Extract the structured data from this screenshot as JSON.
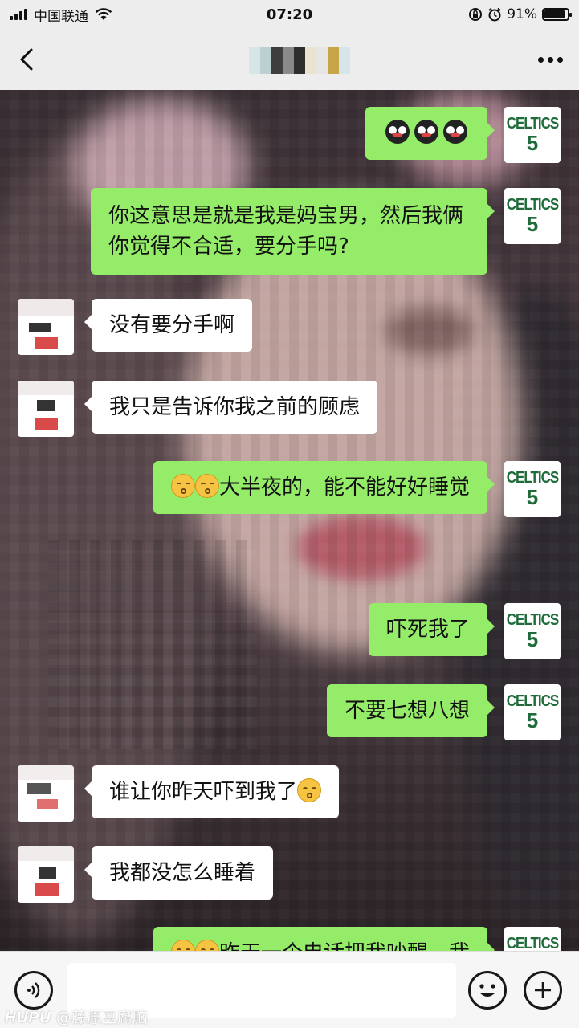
{
  "status_bar": {
    "carrier": "中国联通",
    "time": "07:20",
    "battery": "91%",
    "battery_level": 0.91
  },
  "nav": {
    "back_icon": "chevron-left-icon",
    "more_icon": "more-icon"
  },
  "avatar_me": {
    "line1": "CELTICS",
    "line2": "5",
    "color": "#1f6b3a"
  },
  "messages": [
    {
      "from": "me",
      "text": "",
      "emojis": [
        "eyes-emoji",
        "eyes-emoji",
        "eyes-emoji"
      ]
    },
    {
      "from": "me",
      "text": "你这意思是就是我是妈宝男，然后我俩你觉得不合适，要分手吗?"
    },
    {
      "from": "other",
      "text": "没有要分手啊"
    },
    {
      "from": "other",
      "text": "我只是告诉你我之前的顾虑"
    },
    {
      "from": "me",
      "text": "大半夜的，能不能好好睡觉",
      "emoji_prefix": [
        "blush-emoji",
        "blush-emoji"
      ]
    },
    {
      "from": "me",
      "text": "吓死我了"
    },
    {
      "from": "me",
      "text": "不要七想八想"
    },
    {
      "from": "other",
      "text": "谁让你昨天吓到我了",
      "emoji_suffix": [
        "blush-emoji"
      ]
    },
    {
      "from": "other",
      "text": "我都没怎么睡着"
    },
    {
      "from": "me",
      "text": "昨天一个电话把我吵醒，我",
      "emoji_prefix": [
        "blush-emoji",
        "blush-emoji"
      ]
    }
  ],
  "input_bar": {
    "voice_icon": "voice-icon",
    "emoji_icon": "smile-icon",
    "plus_icon": "plus-icon",
    "value": ""
  },
  "watermark": {
    "brand": "HUPU",
    "user": "@藤原豆腐脑"
  },
  "colors": {
    "bubble_me": "#95ec69",
    "bubble_other": "#ffffff",
    "bar_bg": "#ededed"
  }
}
